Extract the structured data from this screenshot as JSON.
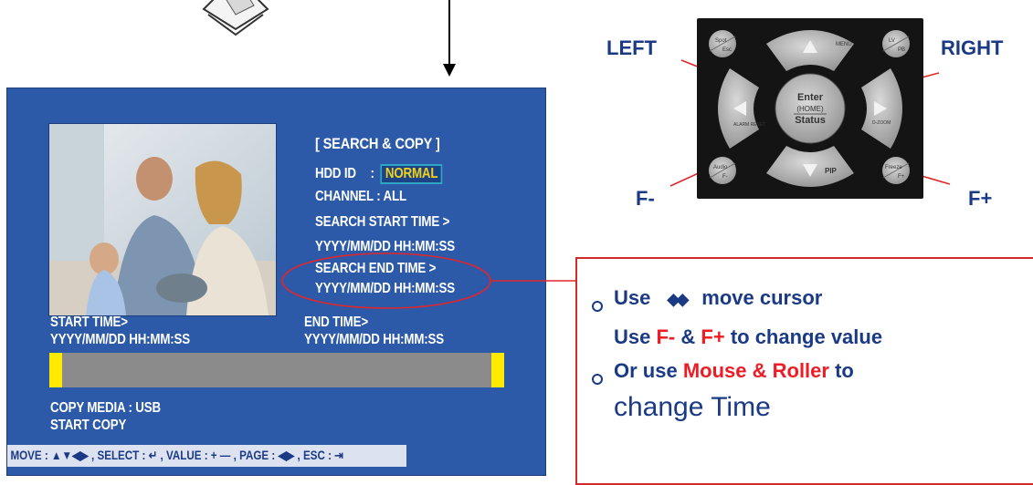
{
  "osd": {
    "title": "[ SEARCH & COPY ]",
    "hdd_label": "HDD ID",
    "hdd_sep": ":",
    "hdd_value": "NORMAL",
    "channel": "CHANNEL : ALL",
    "search_start_label": "SEARCH START TIME >",
    "search_start_value": "YYYY/MM/DD  HH:MM:SS",
    "search_end_label": "SEARCH END TIME >",
    "search_end_value": "YYYY/MM/DD  HH:MM:SS",
    "start_time_label": "START TIME>",
    "start_time_value": "YYYY/MM/DD  HH:MM:SS",
    "end_time_label": "END TIME>",
    "end_time_value": "YYYY/MM/DD  HH:MM:SS",
    "copy_media": "COPY MEDIA : USB",
    "start_copy": "START COPY",
    "help_bar": "MOVE : ▲▼◀▶ , SELECT : ↵ , VALUE : + — , PAGE : ◀▶ , ESC : ⇥"
  },
  "remote": {
    "label_left": "LEFT",
    "label_right": "RIGHT",
    "label_fminus": "F-",
    "label_fplus": "F+",
    "btn_menu": "MENU",
    "btn_pip": "PIP",
    "btn_alarm_reset": "ALARM RESET",
    "btn_dzoom": "D-ZOOM",
    "btn_enter": "Enter",
    "btn_home": "(HOME)",
    "btn_status": "Status",
    "btn_spot": "Spot",
    "btn_esc": "Esc",
    "btn_lv": "LV",
    "btn_pb": "PB",
    "btn_audio": "Audio",
    "btn_f_minus_small": "F-",
    "btn_freeze": "Freeze",
    "btn_f_plus_small": "F+"
  },
  "info": {
    "line1_a": "Use",
    "line1_b": "move cursor",
    "line2_a": "Use",
    "line2_f1": "F-",
    "line2_amp": "&",
    "line2_f2": "F+",
    "line2_b": "to change value",
    "line3_a": "Or use",
    "line3_red": "Mouse & Roller",
    "line3_b": "to",
    "line4": "change Time"
  },
  "colors": {
    "screen_blue": "#2c5aa8",
    "label_navy": "#1b3a86",
    "highlight_red": "#ee1c25",
    "progress_yellow": "#ffea00"
  }
}
